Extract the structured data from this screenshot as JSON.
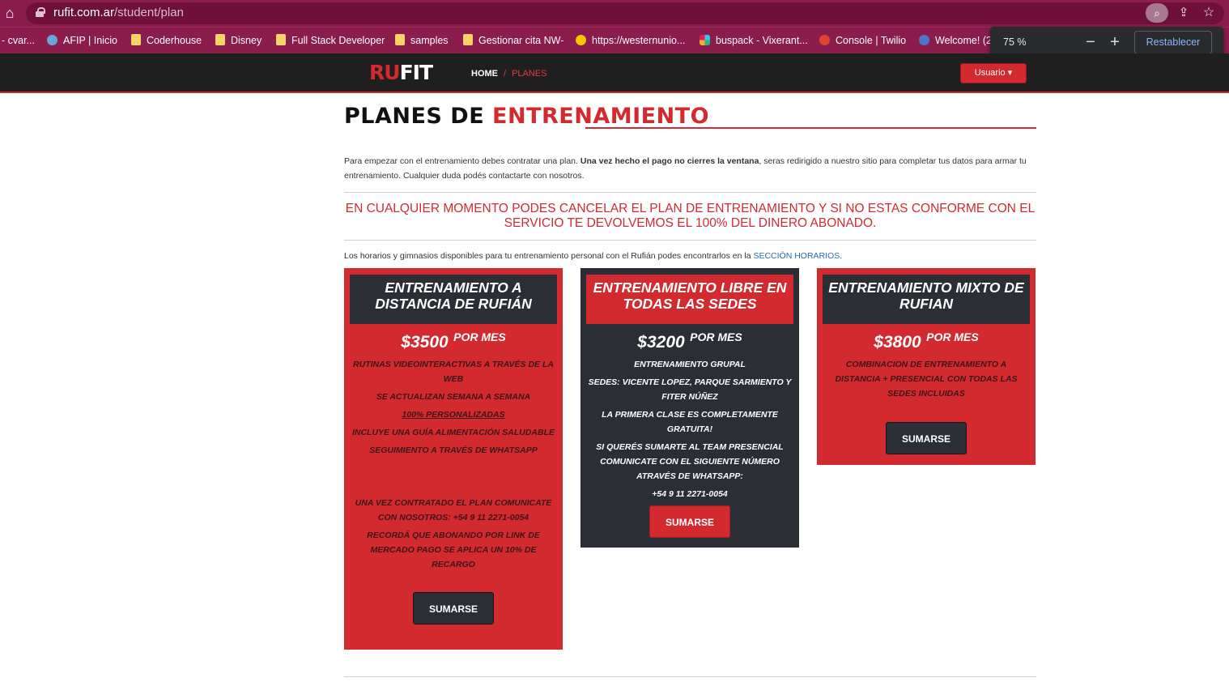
{
  "browser": {
    "url_host": "rufit.com.ar",
    "url_path": "/student/plan",
    "bookmarks": [
      {
        "label": "- cvar...",
        "icon": "none"
      },
      {
        "label": "AFIP | Inicio",
        "icon": "globe"
      },
      {
        "label": "Coderhouse",
        "icon": "folder"
      },
      {
        "label": "Disney",
        "icon": "folder"
      },
      {
        "label": "Full Stack Developer",
        "icon": "folder"
      },
      {
        "label": "samples",
        "icon": "folder"
      },
      {
        "label": "Gestionar cita NW-",
        "icon": "folder"
      },
      {
        "label": "https://westernunio...",
        "icon": "wu"
      },
      {
        "label": "buspack - Vixerant...",
        "icon": "slack"
      },
      {
        "label": "Console | Twilio",
        "icon": "red"
      },
      {
        "label": "Welcome! (2",
        "icon": "mix"
      }
    ],
    "zoom": {
      "value": "75 %",
      "minus": "−",
      "plus": "+",
      "reset": "Restablecer"
    }
  },
  "nav": {
    "logo_a": "RU",
    "logo_b": "F",
    "logo_c": "IT",
    "home": "HOME",
    "sep": "/",
    "planes": "PLANES",
    "user": "Usuario ▾"
  },
  "page": {
    "title_a": "PLANES DE ",
    "title_b": "ENTRENAMIENTO",
    "intro_1": "Para empezar con el entrenamiento debes contratar una plan. ",
    "intro_bold": "Una vez hecho el pago no cierres la ventana",
    "intro_2": ", seras redirigido a nuestro sitio para completar tus datos para armar tu entrenamiento. Cualquier duda podés contactarte con nosotros.",
    "notice": "EN CUALQUIER MOMENTO PODES CANCELAR EL PLAN DE ENTRENAMIENTO Y SI NO ESTAS CONFORME CON EL SERVICIO TE DEVOLVEMOS EL 100% DEL DINERO ABONADO.",
    "horarios_text": "Los horarios y gimnasios disponibles para tu entrenamiento personal con el Rufián podes encontrarlos en la ",
    "horarios_link": "SECCIÓN HORARIOS",
    "horarios_end": "."
  },
  "cards": [
    {
      "title": "ENTRENAMIENTO A DISTANCIA DE RUFIÁN",
      "price": "$3500",
      "per": "POR MES",
      "features": [
        "RUTINAS VIDEOINTERACTIVAS A TRAVÉS DE LA WEB",
        "SE ACTUALIZAN SEMANA A SEMANA",
        "100% PERSONALIZADAS",
        "INCLUYE UNA GUÍA ALIMENTACIÓN SALUDABLE",
        "SEGUIMIENTO A TRAVÉS DE WHATSAPP",
        "UNA VEZ CONTRATADO EL PLAN COMUNICATE CON NOSOTROS: +54 9 11 2271-0054",
        "RECORDÁ QUE ABONANDO POR LINK DE MERCADO PAGO SE APLICA UN 10% DE RECARGO"
      ],
      "button": "SUMARSE"
    },
    {
      "title": "ENTRENAMIENTO LIBRE EN TODAS LAS SEDES",
      "price": "$3200",
      "per": "POR MES",
      "features": [
        "ENTRENAMIENTO GRUPAL",
        "SEDES: VICENTE LOPEZ, PARQUE SARMIENTO Y FITER NÚÑEZ",
        "LA PRIMERA CLASE ES COMPLETAMENTE GRATUITA!",
        "SI QUERÉS SUMARTE AL TEAM PRESENCIAL COMUNICATE CON EL SIGUIENTE NÚMERO ATRAVÉS DE WHATSAPP:",
        "+54 9 11 2271-0054"
      ],
      "button": "SUMARSE"
    },
    {
      "title": "ENTRENAMIENTO MIXTO DE RUFIAN",
      "price": "$3800",
      "per": "POR MES",
      "features": [
        "COMBINACION DE ENTRENAMIENTO A DISTANCIA + PRESENCIAL CON TODAS LAS SEDES INCLUIDAS"
      ],
      "button": "SUMARSE"
    }
  ],
  "colors": {
    "brand_red": "#d32a30",
    "dark": "#2c2e36",
    "browser": "#8a1d4c"
  }
}
